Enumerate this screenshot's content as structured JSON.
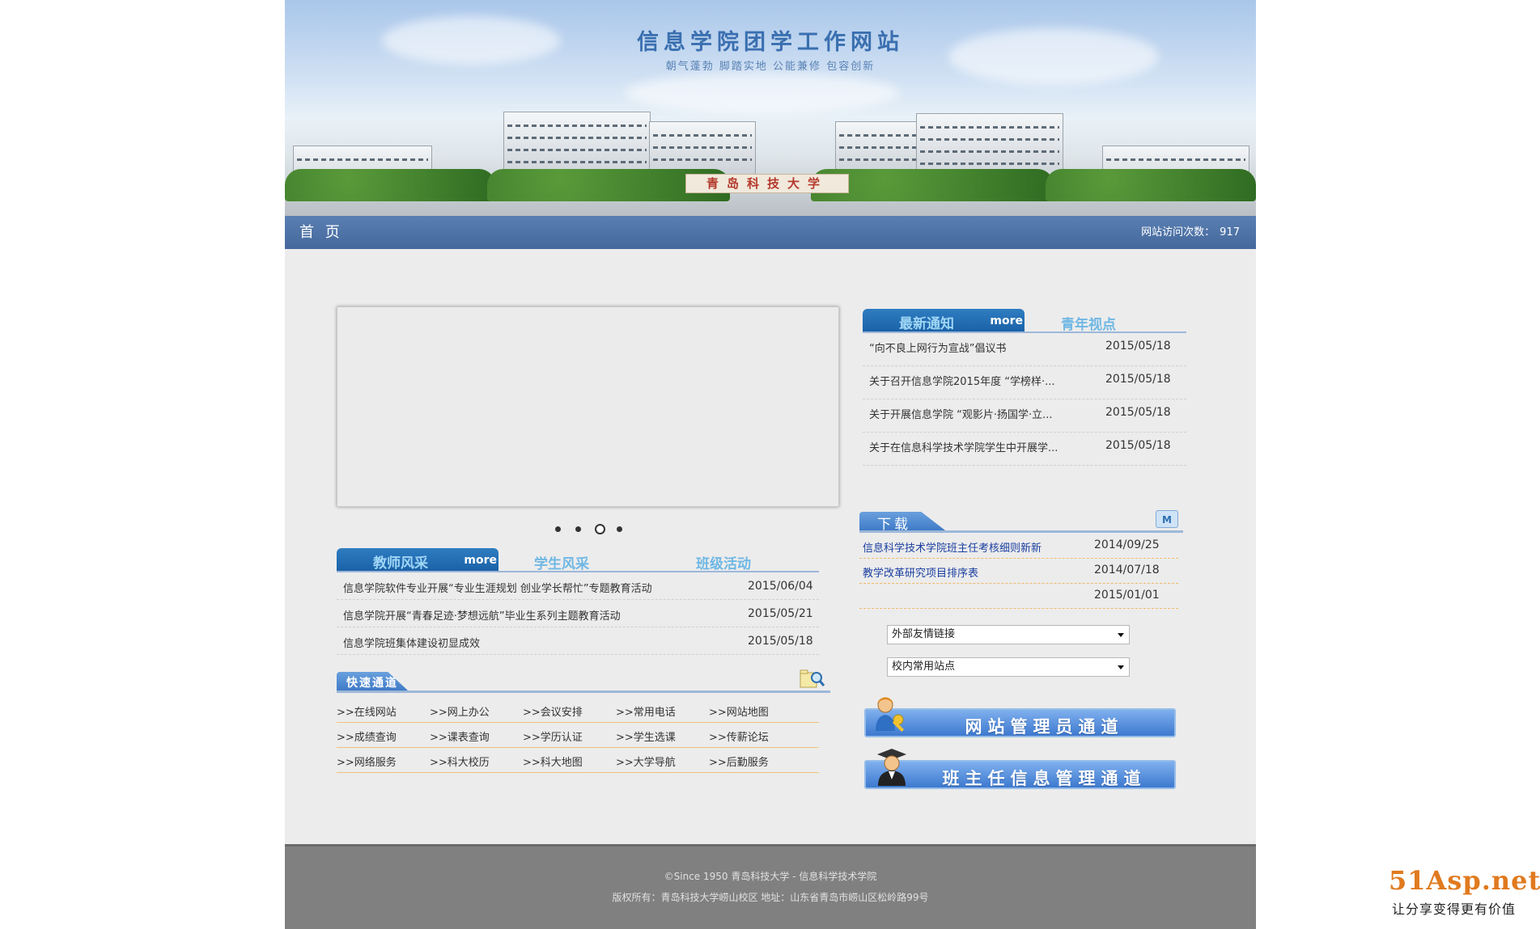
{
  "banner": {
    "site_title": "信息学院团学工作网站",
    "motto": "朝气蓬勃  脚踏实地  公能兼修  包容创新",
    "campus_sign": "青岛科技大学"
  },
  "nav": {
    "home_label": "首 页",
    "visit_counter_label": "网站访问次数：",
    "visit_count": "917"
  },
  "slider": {
    "dot_count": 4,
    "active_index": 2
  },
  "teacher_tabs": {
    "active": "教师风采",
    "more": "more",
    "others": [
      "学生风采",
      "班级活动"
    ],
    "items": [
      {
        "title": "信息学院软件专业开展“专业生涯规划 创业学长帮忙”专题教育活动",
        "date": "2015/06/04"
      },
      {
        "title": "信息学院开展“青春足迹·梦想远航”毕业生系列主题教育活动",
        "date": "2015/05/21"
      },
      {
        "title": "信息学院班集体建设初显成效",
        "date": "2015/05/18"
      }
    ]
  },
  "notice_tabs": {
    "active": "最新通知",
    "more": "more",
    "other": "青年视点",
    "items": [
      {
        "title": "“向不良上网行为宣战”倡议书",
        "date": "2015/05/18"
      },
      {
        "title": "关于召开信息学院2015年度 “学榜样·...",
        "date": "2015/05/18"
      },
      {
        "title": "关于开展信息学院 “观影片·扬国学·立...",
        "date": "2015/05/18"
      },
      {
        "title": "关于在信息科学技术学院学生中开展学...",
        "date": "2015/05/18"
      }
    ]
  },
  "quick_access": {
    "title": "快速通道",
    "rows": [
      [
        ">>在线网站",
        ">>网上办公",
        ">>会议安排",
        ">>常用电话",
        ">>网站地图"
      ],
      [
        ">>成绩查询",
        ">>课表查询",
        ">>学历认证",
        ">>学生选课",
        ">>传薪论坛"
      ],
      [
        ">>网络服务",
        ">>科大校历",
        ">>科大地图",
        ">>大学导航",
        ">>后勤服务"
      ]
    ]
  },
  "downloads": {
    "title": "下载",
    "more_icon_letter": "M",
    "items": [
      {
        "title": "信息科学技术学院班主任考核细则新新",
        "date": "2014/09/25"
      },
      {
        "title": "教学改革研究项目排序表",
        "date": "2014/07/18"
      },
      {
        "title": "",
        "date": "2015/01/01"
      }
    ]
  },
  "links": {
    "external_selected": "外部友情链接",
    "internal_selected": "校内常用站点"
  },
  "portals": {
    "admin": "网站管理员通道",
    "teacher": "班主任信息管理通道"
  },
  "footer": {
    "line1": "©Since 1950 青岛科技大学 - 信息科学技术学院",
    "line2": "版权所有：青岛科技大学崂山校区    地址：山东省青岛市崂山区松岭路99号"
  },
  "watermark": {
    "brand": "51Asp.net",
    "slogan": "让分享变得更有价值"
  },
  "colors": {
    "nav_bar": "#4a6fa5",
    "tab_active": "#1f67ad",
    "tab_inactive_text": "#6fb7e4",
    "footer": "#808080",
    "watermark_brand": "#e07a1f"
  }
}
